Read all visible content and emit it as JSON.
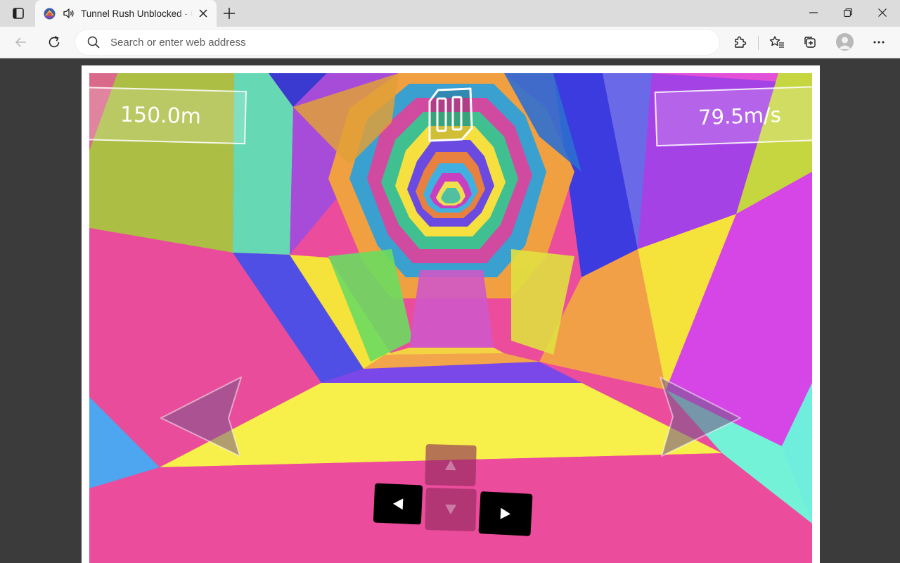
{
  "browser": {
    "tab": {
      "title": "Tunnel Rush Unblocked - G",
      "favicon": "game-favicon",
      "audio_icon": "speaker-icon"
    },
    "address_bar": {
      "placeholder": "Search or enter web address",
      "value": ""
    },
    "icons": [
      "tab-actions-icon",
      "close-icon",
      "plus-icon",
      "minimize-icon",
      "restore-icon",
      "window-close-icon",
      "back-arrow-icon",
      "refresh-icon",
      "search-icon",
      "extensions-icon",
      "favorites-icon",
      "collections-icon",
      "profile-icon",
      "more-icon"
    ]
  },
  "game": {
    "distance": "150.0m",
    "speed": "79.5m/s",
    "controls": {
      "pause": "pause-icon",
      "left_arrow": "left-arrow-icon",
      "right_arrow": "right-arrow-icon",
      "keys": [
        "up-key",
        "down-key",
        "left-key",
        "right-key"
      ]
    }
  }
}
